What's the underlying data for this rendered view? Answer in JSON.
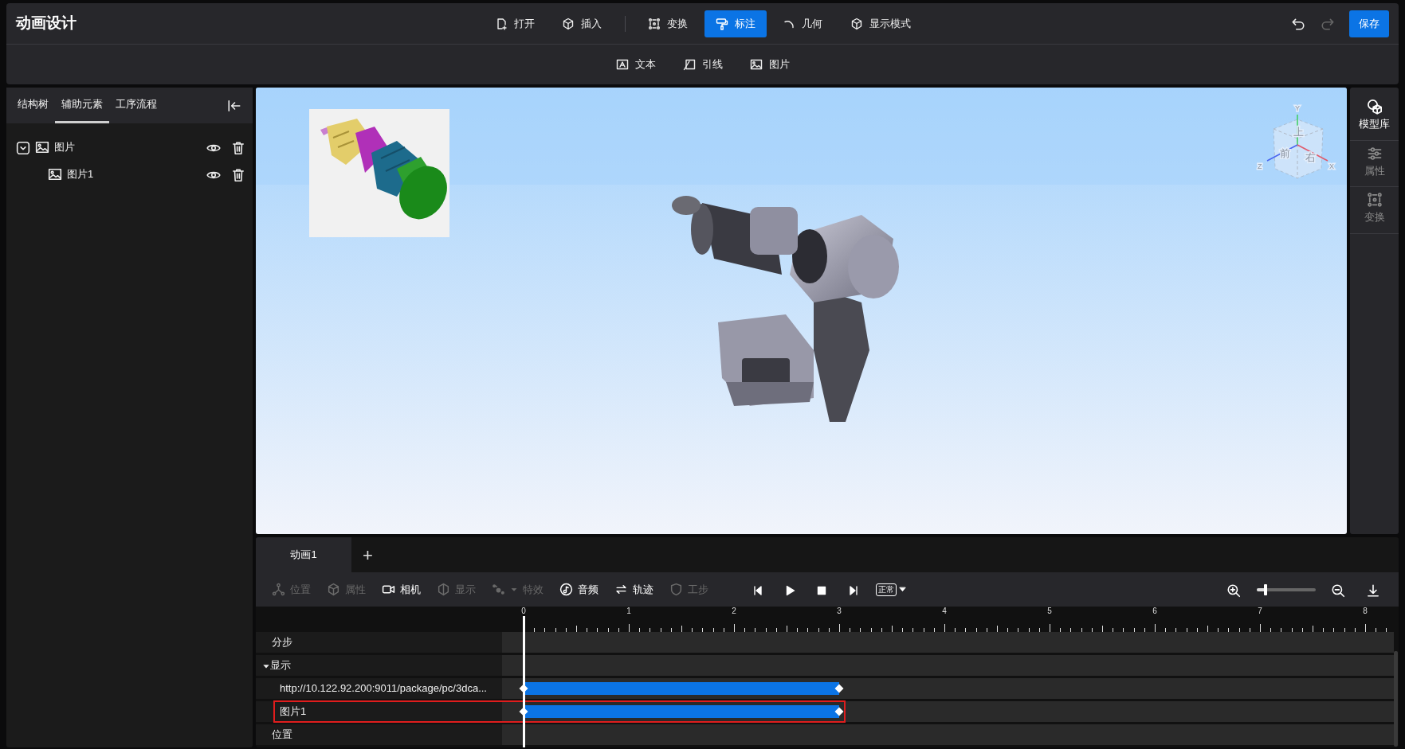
{
  "app_title": "动画设计",
  "tools": [
    {
      "label": "打开",
      "selected": false
    },
    {
      "label": "插入",
      "selected": false
    },
    {
      "label": "变换",
      "selected": false
    },
    {
      "label": "标注",
      "selected": true
    },
    {
      "label": "几何",
      "selected": false
    },
    {
      "label": "显示模式",
      "selected": false
    }
  ],
  "history": [
    {
      "disabled": false
    },
    {
      "disabled": true
    }
  ],
  "save_button": "保存",
  "annotation_tools": [
    "文本",
    "引线",
    "图片"
  ],
  "left_tabs": [
    {
      "label": "结构树",
      "selected": false
    },
    {
      "label": "辅助元素",
      "selected": true
    },
    {
      "label": "工序流程",
      "selected": false
    }
  ],
  "tree": [
    {
      "label": "图片",
      "expanded": true,
      "children": [
        {
          "label": "图片1"
        }
      ]
    }
  ],
  "view_cube": {
    "top": "上",
    "front": "前",
    "right": "右",
    "x": "X",
    "y": "Y",
    "z": "Z"
  },
  "right_sidebar": [
    {
      "label": "模型库",
      "selected": true
    },
    {
      "label": "属性",
      "selected": false
    },
    {
      "label": "变换",
      "selected": false
    }
  ],
  "timeline": {
    "tabs": [
      {
        "label": "动画1",
        "selected": true
      }
    ],
    "add_tab": "+",
    "tools": [
      {
        "label": "位置",
        "disabled": true
      },
      {
        "label": "属性",
        "disabled": true
      },
      {
        "label": "相机",
        "disabled": false
      },
      {
        "label": "显示",
        "disabled": true
      },
      {
        "label": "特效",
        "disabled": true
      },
      {
        "label": "音频",
        "disabled": false
      },
      {
        "label": "轨迹",
        "disabled": false
      },
      {
        "label": "工步",
        "disabled": true
      }
    ],
    "speed_label": "正常",
    "zoom_slider": {
      "level": 0.15
    },
    "ruler_ticks": [
      "0",
      "1",
      "2",
      "3",
      "4",
      "5",
      "6",
      "7",
      "8"
    ],
    "playhead": {
      "level": 0
    },
    "tracks": [
      {
        "label": "分步",
        "kind": "track",
        "selected": false
      },
      {
        "label": "显示",
        "kind": "group",
        "expanded": true,
        "selected": false,
        "children": [
          {
            "label": "http://10.122.92.200:9011/package/pc/3dca...",
            "kind": "clip",
            "selected": false
          },
          {
            "label": "图片1",
            "kind": "clip",
            "selected": true
          }
        ]
      },
      {
        "label": "位置",
        "kind": "track",
        "selected": false
      }
    ]
  }
}
